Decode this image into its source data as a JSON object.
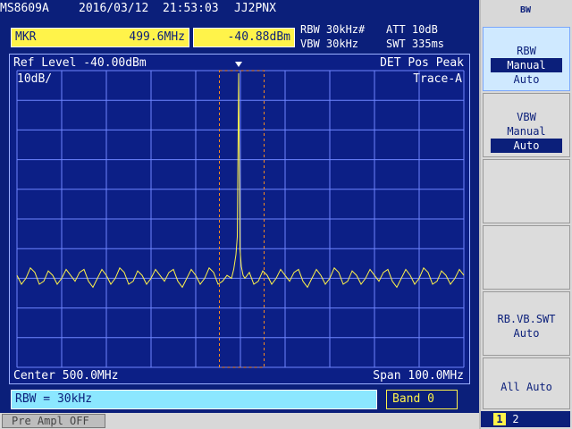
{
  "header": {
    "model": "MS8609A",
    "date": "2016/03/12",
    "time": "21:53:03",
    "callsign": "JJ2PNX"
  },
  "marker": {
    "label": "MKR",
    "freq": "499.6MHz",
    "level": "-40.88dBm"
  },
  "settings": {
    "rbw": "RBW 30kHz#",
    "att": "ATT 10dB",
    "vbw": "VBW 30kHz",
    "swt": "SWT 335ms"
  },
  "graph": {
    "ref_level": "Ref Level -40.00dBm",
    "det": "DET  Pos Peak",
    "scale": "10dB/",
    "trace": "Trace-A",
    "center": "Center 500.0MHz",
    "span": "Span 100.0MHz"
  },
  "status": {
    "rbw_entry": "RBW = 30kHz",
    "band": "Band 0",
    "preamp": "Pre Ampl OFF"
  },
  "softkeys": {
    "title": "BW",
    "rbw": {
      "title": "RBW",
      "opt1": "Manual",
      "opt2": "Auto"
    },
    "vbw": {
      "title": "VBW",
      "opt1": "Manual",
      "opt2": "Auto"
    },
    "rbvbswt": {
      "title": "RB.VB.SWT",
      "opt": "Auto"
    },
    "all_auto": "All Auto",
    "page1": "1",
    "page2": "2"
  },
  "colors": {
    "background": "#0b1f7a",
    "trace": "#fff34a",
    "grid": "#6f86ff",
    "marker_box": "#fff34a",
    "entry_box": "#8be7ff",
    "window": "#ff8a1f"
  },
  "chart_data": {
    "type": "line",
    "title": "Ref Level -40.00dBm",
    "xlabel": "",
    "ylabel": "",
    "x_center_mhz": 500.0,
    "x_span_mhz": 100.0,
    "x_range_mhz": [
      450.0,
      550.0
    ],
    "y_ref_dbm": -40.0,
    "y_scale_db_per_div": 10,
    "y_divisions": 10,
    "y_range_dbm": [
      -140.0,
      -40.0
    ],
    "grid": true,
    "marker": {
      "x_mhz": 499.6,
      "y_dbm": -40.88
    },
    "series": [
      {
        "x_mhz": [
          450,
          452,
          454,
          456,
          458,
          460,
          462,
          464,
          466,
          468,
          470,
          472,
          474,
          476,
          478,
          480,
          482,
          484,
          486,
          488,
          490,
          492,
          494,
          496,
          497,
          498,
          498.5,
          499,
          499.3,
          499.6,
          499.9,
          500.2,
          500.6,
          501,
          502,
          504,
          506,
          508,
          510,
          512,
          514,
          516,
          518,
          520,
          522,
          524,
          526,
          528,
          530,
          532,
          534,
          536,
          538,
          540,
          542,
          544,
          546,
          548,
          550
        ],
        "y_dbm": [
          -109,
          -110,
          -108,
          -111,
          -109,
          -110,
          -109,
          -108,
          -111,
          -110,
          -109,
          -110,
          -108,
          -111,
          -109,
          -110,
          -109,
          -108,
          -111,
          -110,
          -109,
          -110,
          -108,
          -111,
          -109,
          -110,
          -107,
          -102,
          -96,
          -40.88,
          -100,
          -106,
          -109,
          -110,
          -108,
          -111,
          -109,
          -110,
          -109,
          -108,
          -111,
          -110,
          -109,
          -110,
          -108,
          -111,
          -109,
          -110,
          -109,
          -108,
          -111,
          -110,
          -109,
          -110,
          -108,
          -111,
          -109,
          -110,
          -109
        ]
      }
    ],
    "span_window_mhz": [
      495.3,
      505.3
    ]
  }
}
